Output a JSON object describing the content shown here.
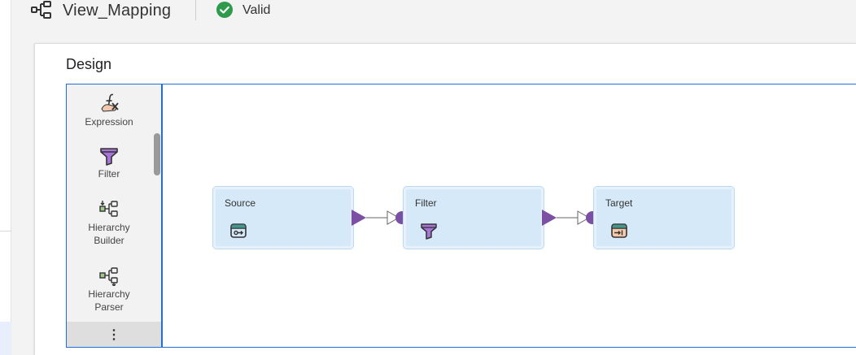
{
  "header": {
    "mapping_icon": "mapping-icon",
    "title": "View_Mapping",
    "status_icon": "check-circle-icon",
    "status_text": "Valid",
    "status_color": "#2e9a4b"
  },
  "design": {
    "title": "Design",
    "border_color": "#1e6fd9"
  },
  "palette": {
    "items": [
      {
        "label": "Expression",
        "icon": "expression-icon"
      },
      {
        "label": "Filter",
        "icon": "filter-icon"
      },
      {
        "label_line1": "Hierarchy",
        "label_line2": "Builder",
        "icon": "hierarchy-builder-icon"
      },
      {
        "label_line1": "Hierarchy",
        "label_line2": "Parser",
        "icon": "hierarchy-parser-icon"
      }
    ],
    "more": "⋮"
  },
  "canvas": {
    "nodes": [
      {
        "label": "Source",
        "icon": "source-icon"
      },
      {
        "label": "Filter",
        "icon": "filter-icon"
      },
      {
        "label": "Target",
        "icon": "target-icon"
      }
    ],
    "port_color": "#7b4fa3",
    "node_color": "#d6e9f8"
  }
}
